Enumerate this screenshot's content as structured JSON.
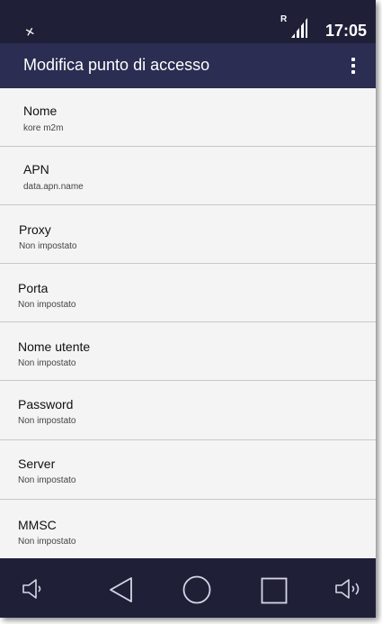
{
  "status_bar": {
    "roaming_indicator": "R",
    "time": "17:05",
    "left_icon": "no-sim-icon",
    "signal_icon": "signal-icon"
  },
  "app_bar": {
    "title": "Modifica punto di accesso",
    "menu_icon": "more-vert-icon"
  },
  "items": [
    {
      "name": "nome",
      "label": "Nome",
      "value": "kore m2m"
    },
    {
      "name": "apn",
      "label": "APN",
      "value": "data.apn.name"
    },
    {
      "name": "proxy",
      "label": "Proxy",
      "value": "Non impostato"
    },
    {
      "name": "porta",
      "label": "Porta",
      "value": "Non impostato"
    },
    {
      "name": "nome-utente",
      "label": "Nome utente",
      "value": "Non impostato"
    },
    {
      "name": "password",
      "label": "Password",
      "value": "Non impostato"
    },
    {
      "name": "server",
      "label": "Server",
      "value": "Non impostato"
    },
    {
      "name": "mmsc",
      "label": "MMSC",
      "value": "Non impostato"
    }
  ],
  "nav_bar": {
    "buttons": [
      "volume-down-icon",
      "back-icon",
      "home-icon",
      "recents-icon",
      "volume-up-icon"
    ]
  },
  "colors": {
    "status_bar": "#1f2038",
    "app_bar": "#2b2d52",
    "list_bg": "#f4f4f4",
    "divider": "#c8c8c8"
  }
}
